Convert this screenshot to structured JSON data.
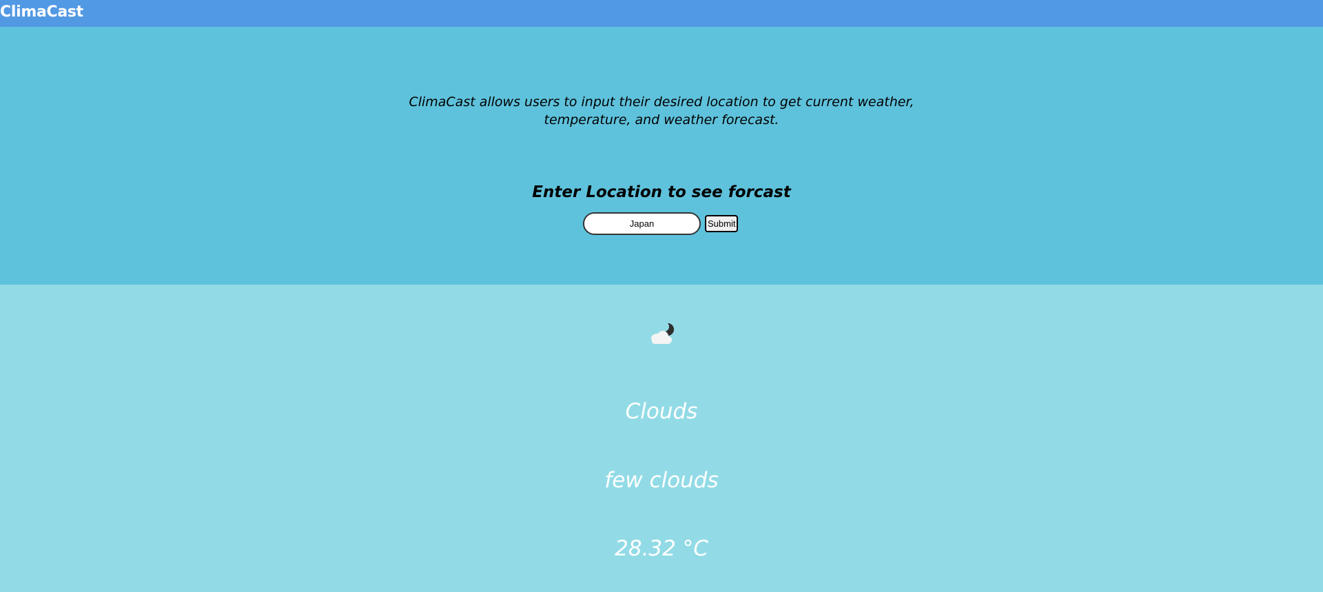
{
  "app": {
    "title": "ClimaCast"
  },
  "hero": {
    "intro_text": "ClimaCast allows users to input their desired location to get current weather, temperature, and weather forecast.",
    "prompt": "Enter Location to see forcast"
  },
  "search": {
    "value": "Japan",
    "submit_label": "Submit"
  },
  "weather": {
    "icon": "few-clouds-night-icon",
    "condition": "Clouds",
    "description": "few clouds",
    "temperature": "28.32 °C"
  },
  "colors": {
    "navbar": "#5299e4",
    "hero_bg": "#5fc2dc",
    "weather_bg": "#92dbe6",
    "text_light": "#ffffff"
  }
}
